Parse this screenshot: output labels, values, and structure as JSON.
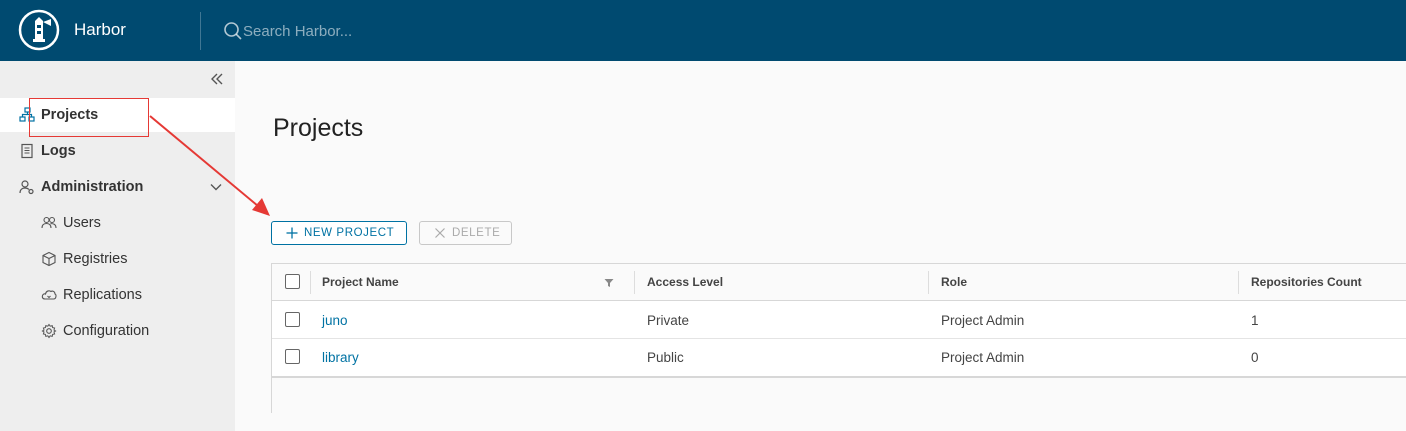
{
  "header": {
    "app_title": "Harbor",
    "search_placeholder": "Search Harbor...",
    "background_color": "#004a70"
  },
  "sidebar": {
    "collapse_icon": "double-chevron-left-icon",
    "items": [
      {
        "label": "Projects",
        "icon": "projects-icon",
        "active": true
      },
      {
        "label": "Logs",
        "icon": "logs-icon"
      },
      {
        "label": "Administration",
        "icon": "administration-icon",
        "expanded": true
      },
      {
        "label": "Users",
        "icon": "users-icon"
      },
      {
        "label": "Registries",
        "icon": "registries-icon"
      },
      {
        "label": "Replications",
        "icon": "replications-icon"
      },
      {
        "label": "Configuration",
        "icon": "configuration-icon"
      }
    ]
  },
  "main": {
    "title": "Projects",
    "toolbar": {
      "new_project_label": "NEW PROJECT",
      "delete_label": "DELETE"
    },
    "table": {
      "columns": [
        "Project Name",
        "Access Level",
        "Role",
        "Repositories Count"
      ],
      "rows": [
        {
          "name": "juno",
          "access": "Private",
          "role": "Project Admin",
          "repos": "1"
        },
        {
          "name": "library",
          "access": "Public",
          "role": "Project Admin",
          "repos": "0"
        }
      ]
    }
  },
  "colors": {
    "accent": "#0072a3",
    "annotation": "#e53935"
  }
}
